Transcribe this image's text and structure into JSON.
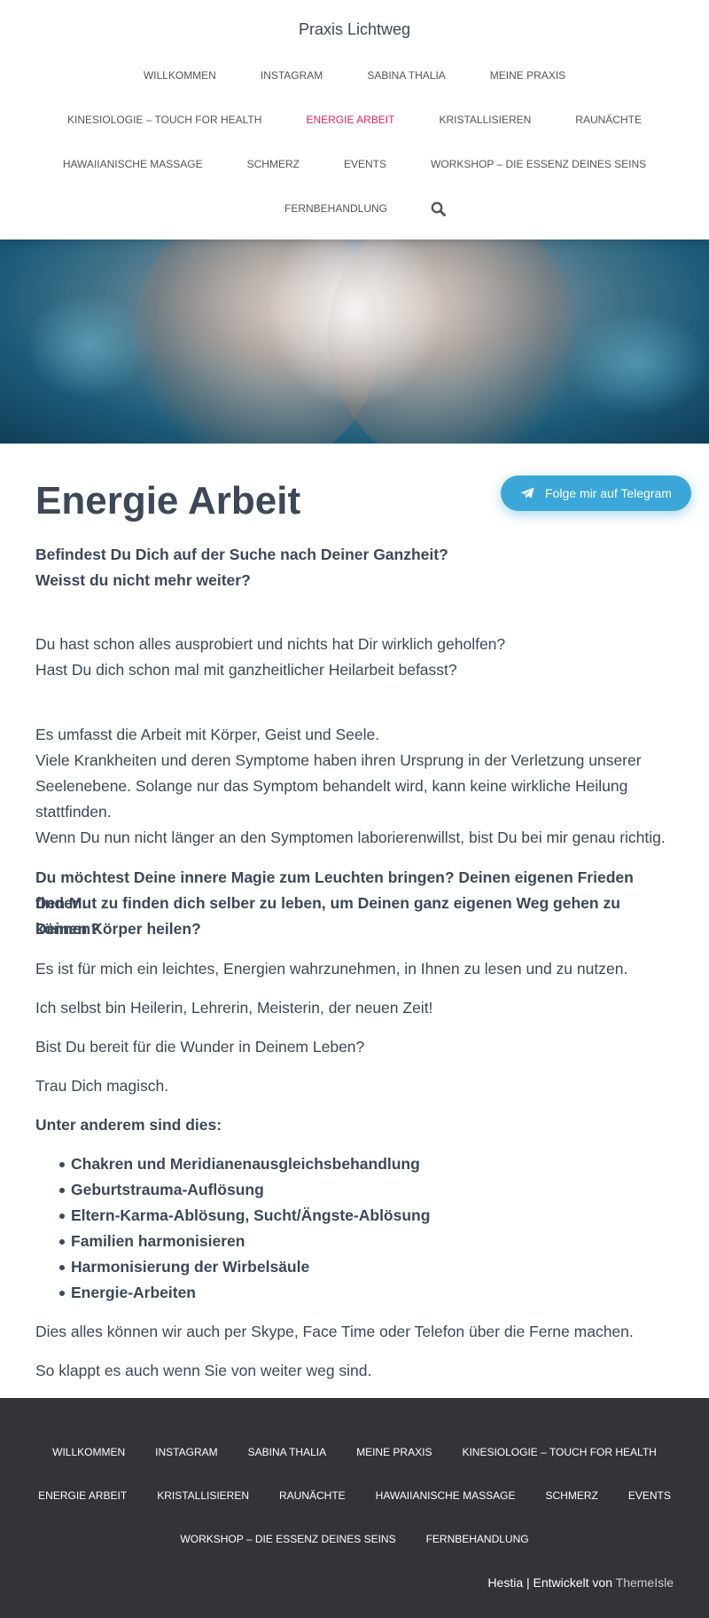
{
  "brand": "Praxis Lichtweg",
  "nav": {
    "row1": [
      "Willkommen",
      "Instagram",
      "Sabina Thalia",
      "Meine Praxis"
    ],
    "row2": [
      "Kinesiologie – Touch for Health",
      "Energie Arbeit",
      "Kristallisieren",
      "Raunächte"
    ],
    "row3": [
      "Hawaiianische Massage",
      "Schmerz",
      "Events",
      "Workshop – Die Essenz Deines Seins"
    ],
    "row4": [
      "Fernbehandlung"
    ],
    "active": "Energie Arbeit"
  },
  "page": {
    "title": "Energie Arbeit",
    "telegram_label": "Folge mir auf Telegram",
    "p1_line1": "Befindest Du Dich auf der Suche nach Deiner Ganzheit?",
    "p1_line2": "Weisst du nicht mehr weiter?",
    "p2_line1": "Du hast schon alles ausprobiert und nichts hat Dir wirklich geholfen?",
    "p2_line2": "Hast Du dich schon mal mit ganzheitlicher Heilarbeit befasst?",
    "p3_line1": "Es umfasst die Arbeit mit Körper, Geist und Seele.",
    "p3_line2": "Viele Krankheiten und deren Symptome haben ihren Ursprung in der Verletzung unserer",
    "p3_line3": "Seelenebene. Solange nur das Symptom behandelt wird, kann keine wirkliche Heilung",
    "p3_line4": "stattfinden.",
    "p3_line5": "Wenn Du nun nicht länger an den Symptomen laborierenwillst, bist Du bei mir genau richtig.",
    "p4_line1": "Du möchtest Deine innere Magie zum Leuchten bringen? Deinen eigenen Frieden finden.",
    "p4_line2": "Den Mut zu finden dich selber zu leben, um Deinen ganz eigenen Weg gehen zu können?",
    "p4_line3": "Deinen Körper heilen?",
    "p5": "Es ist für mich ein leichtes, Energien wahrzunehmen, in Ihnen zu lesen und zu nutzen.",
    "p6": "Ich selbst bin Heilerin, Lehrerin, Meisterin, der neuen Zeit!",
    "p7": "Bist Du bereit für die Wunder in Deinem Leben?",
    "p8": "Trau Dich magisch.",
    "list_heading": "Unter anderem sind dies:",
    "list": [
      "Chakren und Meridianenausgleichsbehandlung",
      "Geburtstrauma-Auflösung",
      "Eltern-Karma-Ablösung, Sucht/Ängste-Ablösung",
      "Familien harmonisieren",
      "Harmonisierung der Wirbelsäule",
      "Energie-Arbeiten"
    ],
    "p9": "Dies alles können wir auch per Skype, Face Time oder Telefon über die Ferne machen.",
    "p10": "So klappt  es auch wenn Sie von weiter weg sind."
  },
  "footer": {
    "row1": [
      "Willkommen",
      "Instagram",
      "Sabina Thalia",
      "Meine Praxis",
      "Kinesiologie – Touch for Health"
    ],
    "row2": [
      "Energie Arbeit",
      "Kristallisieren",
      "Raunächte",
      "Hawaiianische Massage",
      "Schmerz",
      "Events"
    ],
    "row3": [
      "Workshop – Die Essenz Deines Seins",
      "Fernbehandlung"
    ],
    "credit_prefix": "Hestia | Entwickelt von ",
    "credit_link": "ThemeIsle"
  },
  "colors": {
    "accent": "#e91e63",
    "telegram": "#3aa7d8",
    "footer_bg": "#323437",
    "text": "#3c4858"
  }
}
